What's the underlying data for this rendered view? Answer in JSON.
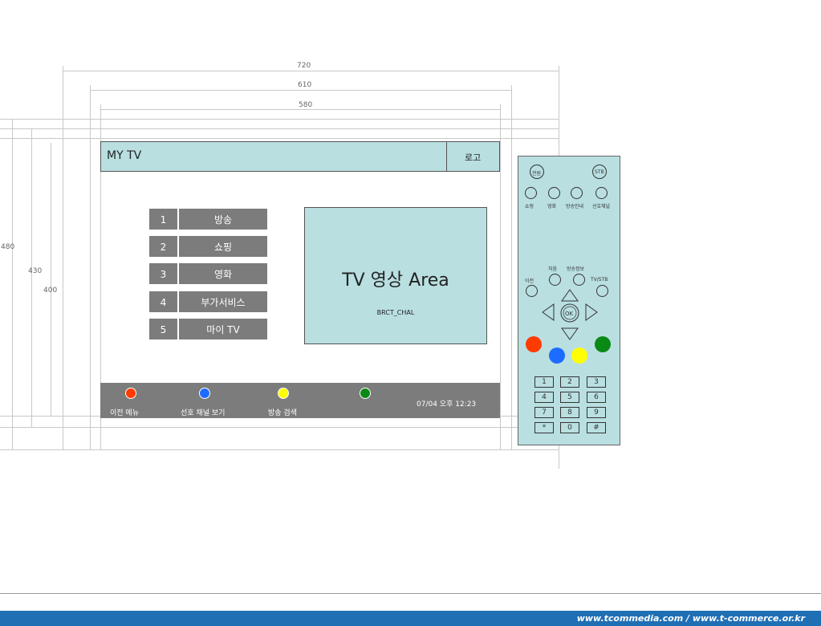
{
  "dimensions": {
    "w720": "720",
    "w610": "610",
    "w580": "580",
    "h480": "480",
    "h430": "430",
    "h400": "400"
  },
  "screen": {
    "title": "MY TV",
    "logo_label": "로고",
    "menu": [
      {
        "num": "1",
        "label": "방송"
      },
      {
        "num": "2",
        "label": "쇼핑"
      },
      {
        "num": "3",
        "label": "영화"
      },
      {
        "num": "4",
        "label": "부가서비스"
      },
      {
        "num": "5",
        "label": "마이 TV"
      }
    ],
    "tv_area_label": "TV 영상 Area",
    "tv_area_sub": "BRCT_CHAL",
    "bottom": {
      "prev_menu": "이전 메뉴",
      "favorite": "선호 채널 보기",
      "search": "방송 검색",
      "datetime": "07/04 오후 12:23"
    },
    "colors": {
      "red": "#ff3b00",
      "blue": "#1e6cff",
      "yellow": "#ffff00",
      "green": "#0a8a14"
    }
  },
  "remote": {
    "power": "전원",
    "stb": "STB",
    "top_labels": [
      "쇼핑",
      "영화",
      "방송안내",
      "선호채널"
    ],
    "first": "처음",
    "info": "방송정보",
    "prev": "이전",
    "tvstb": "TV/STB",
    "ok": "OK",
    "keys": [
      "1",
      "2",
      "3",
      "4",
      "5",
      "6",
      "7",
      "8",
      "9",
      "*",
      "0",
      "#"
    ]
  },
  "footer": {
    "url": "www.tcommedia.com / www.t-commerce.or.kr"
  }
}
